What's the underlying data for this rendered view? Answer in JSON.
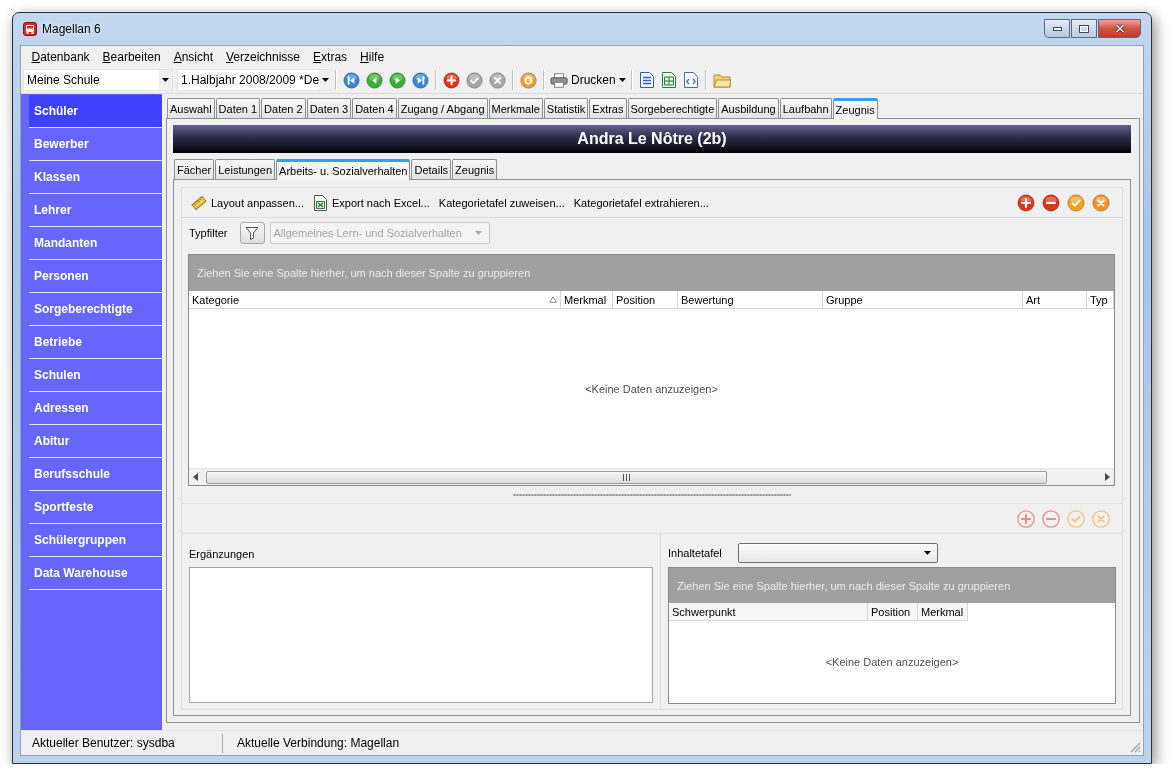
{
  "window": {
    "title": "Magellan 6"
  },
  "menu": [
    {
      "label": "Datenbank"
    },
    {
      "label": "Bearbeiten"
    },
    {
      "label": "Ansicht"
    },
    {
      "label": "Verzeichnisse"
    },
    {
      "label": "Extras"
    },
    {
      "label": "Hilfe"
    }
  ],
  "toolbar": {
    "school_select": {
      "value": "Meine Schule"
    },
    "term_select": {
      "value": "1.Halbjahr 2008/2009 *De"
    },
    "groups": [
      [
        {
          "kind": "first",
          "disabled": false
        },
        {
          "kind": "previous",
          "disabled": false
        },
        {
          "kind": "next",
          "disabled": false
        },
        {
          "kind": "last",
          "disabled": false
        }
      ],
      [
        {
          "kind": "add",
          "disabled": false
        },
        {
          "kind": "confirm",
          "disabled": true
        },
        {
          "kind": "cancel",
          "disabled": true
        }
      ],
      [
        {
          "kind": "refresh",
          "disabled": false
        }
      ],
      [
        {
          "kind": "print",
          "label": "Drucken",
          "disabled": false
        }
      ],
      [
        {
          "kind": "document",
          "disabled": false
        },
        {
          "kind": "spreadsheet",
          "disabled": false
        },
        {
          "kind": "webpage",
          "disabled": false
        }
      ],
      [
        {
          "kind": "folder",
          "disabled": false
        }
      ]
    ]
  },
  "sidebar": {
    "items": [
      {
        "label": "Schüler",
        "selected": true
      },
      {
        "label": "Bewerber",
        "selected": false
      },
      {
        "label": "Klassen",
        "selected": false
      },
      {
        "label": "Lehrer",
        "selected": false
      },
      {
        "label": "Mandanten",
        "selected": false
      },
      {
        "label": "Personen",
        "selected": false
      },
      {
        "label": "Sorgeberechtigte",
        "selected": false
      },
      {
        "label": "Betriebe",
        "selected": false
      },
      {
        "label": "Schulen",
        "selected": false
      },
      {
        "label": "Adressen",
        "selected": false
      },
      {
        "label": "Abitur",
        "selected": false
      },
      {
        "label": "Berufsschule",
        "selected": false
      },
      {
        "label": "Sportfeste",
        "selected": false
      },
      {
        "label": "Schülergruppen",
        "selected": false
      },
      {
        "label": "Data Warehouse",
        "selected": false
      }
    ]
  },
  "tabs": [
    {
      "label": "Auswahl",
      "selected": false
    },
    {
      "label": "Daten 1",
      "selected": false
    },
    {
      "label": "Daten 2",
      "selected": false
    },
    {
      "label": "Daten 3",
      "selected": false
    },
    {
      "label": "Daten 4",
      "selected": false
    },
    {
      "label": "Zugang / Abgang",
      "selected": false
    },
    {
      "label": "Merkmale",
      "selected": false
    },
    {
      "label": "Statistik",
      "selected": false
    },
    {
      "label": "Extras",
      "selected": false
    },
    {
      "label": "Sorgeberechtigte",
      "selected": false
    },
    {
      "label": "Ausbildung",
      "selected": false
    },
    {
      "label": "Laufbahn",
      "selected": false
    },
    {
      "label": "Zeugnis",
      "selected": true
    }
  ],
  "student": {
    "title": "Andra Le Nôtre (2b)"
  },
  "subtabs": [
    {
      "label": "Fächer",
      "selected": false
    },
    {
      "label": "Leistungen",
      "selected": false
    },
    {
      "label": "Arbeits- u. Sozialverhalten",
      "selected": true
    },
    {
      "label": "Details",
      "selected": false
    },
    {
      "label": "Zeugnis",
      "selected": false
    }
  ],
  "actions": [
    {
      "kind": "layout",
      "label": "Layout anpassen..."
    },
    {
      "kind": "export",
      "label": "Export nach Excel..."
    },
    {
      "kind": "assign",
      "label": "Kategorietafel zuweisen..."
    },
    {
      "kind": "extract",
      "label": "Kategorietafel extrahieren..."
    }
  ],
  "record_buttons": [
    {
      "kind": "add",
      "disabled": false
    },
    {
      "kind": "remove",
      "disabled": false
    },
    {
      "kind": "confirm",
      "disabled": false
    },
    {
      "kind": "cancel",
      "disabled": false
    }
  ],
  "type_filter": {
    "label": "Typfilter",
    "value": "Allgemeines Lern- und Sozialverhalten",
    "disabled": true
  },
  "category_grid": {
    "group_hint": "Ziehen Sie eine Spalte hierher, um nach dieser Spalte zu gruppieren",
    "columns": [
      {
        "label": "Kategorie",
        "sorted": true
      },
      {
        "label": "Merkmal",
        "sorted": false
      },
      {
        "label": "Position",
        "sorted": false
      },
      {
        "label": "Bewertung",
        "sorted": false
      },
      {
        "label": "Gruppe",
        "sorted": false
      },
      {
        "label": "Art",
        "sorted": false
      },
      {
        "label": "Typ",
        "sorted": false
      }
    ],
    "empty_text": "<Keine Daten anzuzeigen>"
  },
  "detail_buttons": [
    {
      "kind": "add",
      "disabled": true
    },
    {
      "kind": "remove",
      "disabled": true
    },
    {
      "kind": "confirm",
      "disabled": true
    },
    {
      "kind": "cancel",
      "disabled": true
    }
  ],
  "supplements": {
    "label": "Ergänzungen"
  },
  "content_table": {
    "label": "Inhaltetafel",
    "grid": {
      "group_hint": "Ziehen Sie eine Spalte hierher, um nach dieser Spalte zu gruppieren",
      "columns": [
        {
          "label": "Schwerpunkt",
          "sorted": false
        },
        {
          "label": "Position",
          "sorted": false
        },
        {
          "label": "Merkmal",
          "sorted": false
        }
      ],
      "empty_text": "<Keine Daten anzuzeigen>"
    }
  },
  "status_bar": [
    {
      "text": "Aktueller Benutzer: sysdba"
    },
    {
      "text": "Aktuelle Verbindung: Magellan"
    }
  ]
}
